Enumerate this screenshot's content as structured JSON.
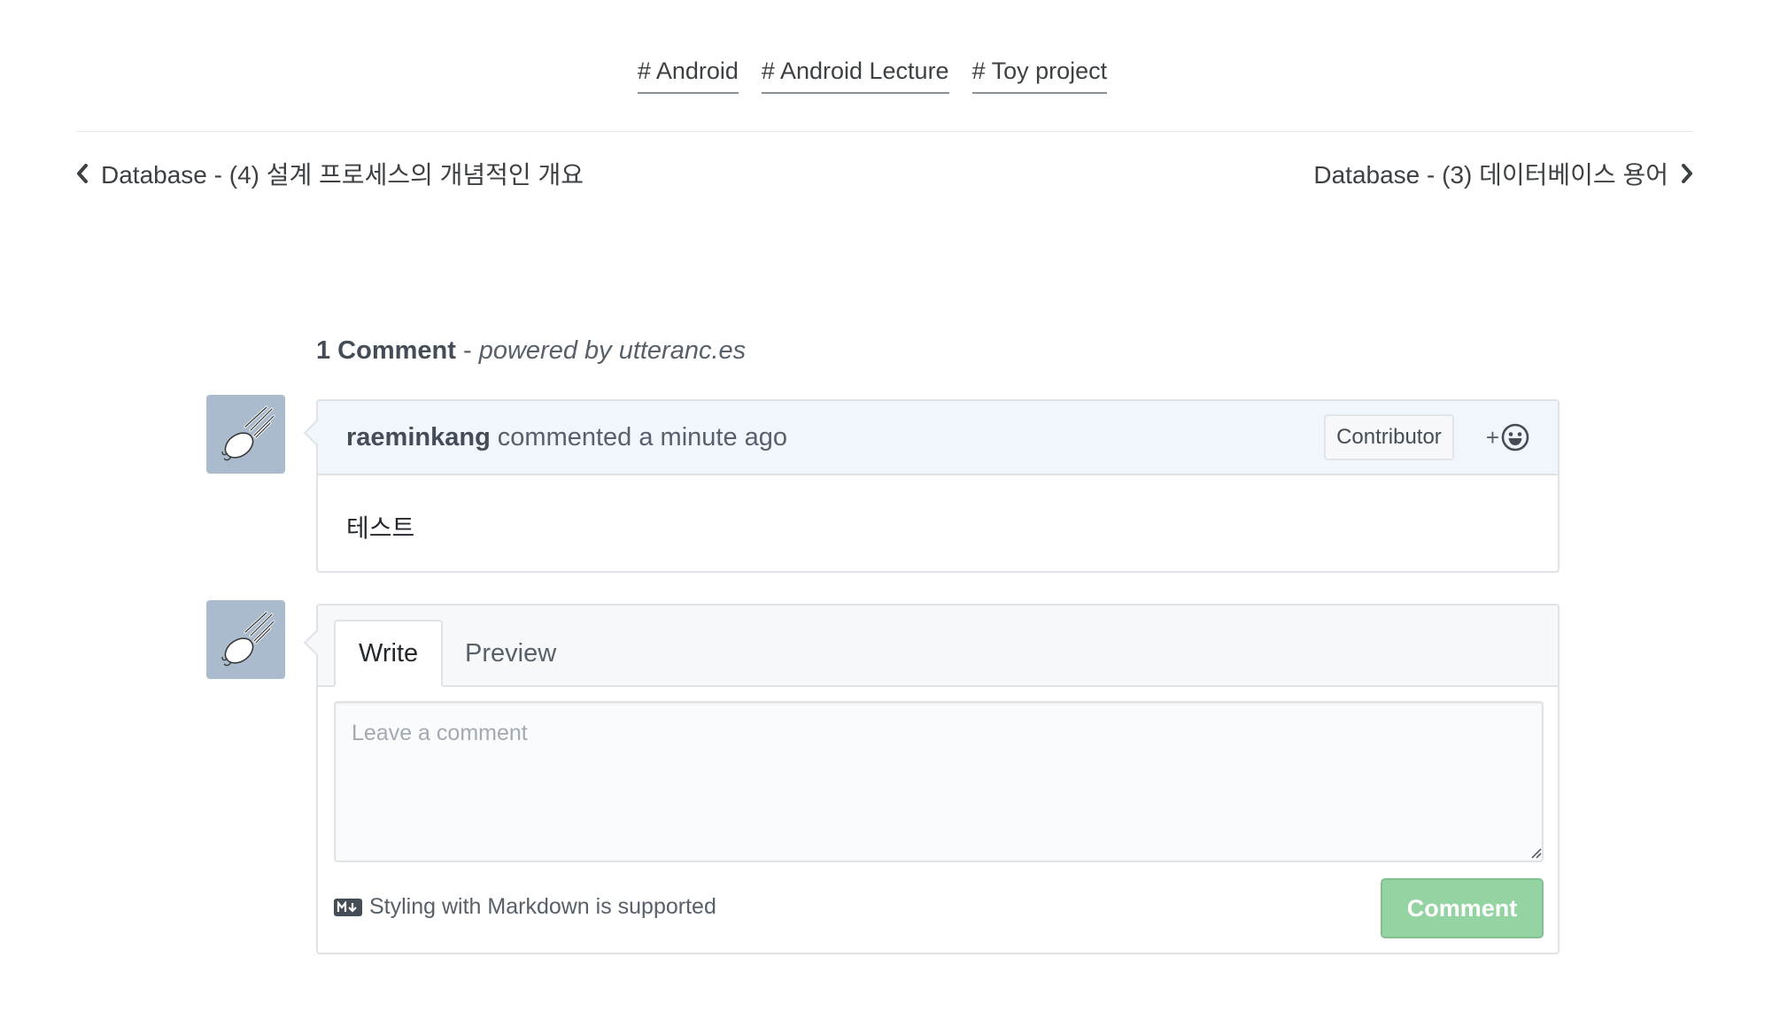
{
  "tags": [
    {
      "label": "# Android"
    },
    {
      "label": "# Android Lecture"
    },
    {
      "label": "# Toy project"
    }
  ],
  "post_nav": {
    "previous": {
      "label": "Database - (4) 설계 프로세스의 개념적인 개요",
      "icon": "chevron-left-icon"
    },
    "next": {
      "label": "Database - (3) 데이터베이스 용어",
      "icon": "chevron-right-icon"
    }
  },
  "comments_section": {
    "count_label": "1 Comment",
    "separator": " - ",
    "powered_by": "powered by utteranc.es"
  },
  "comment": {
    "author": "raeminkang",
    "action": "commented a minute ago",
    "badge": "Contributor",
    "reaction_label": "+",
    "reaction_icon": "smiley-icon",
    "body": "테스트",
    "avatar_icon": "comet-avatar-icon"
  },
  "form": {
    "tabs": [
      {
        "label": "Write",
        "active": true
      },
      {
        "label": "Preview",
        "active": false
      }
    ],
    "placeholder": "Leave a comment",
    "markdown_note": "Styling with Markdown is supported",
    "markdown_icon": "markdown-icon",
    "submit_label": "Comment"
  },
  "colors": {
    "avatar_bg": "#a9bbcc",
    "header_bg": "#f1f6fd",
    "submit_disabled": "#94d3a2"
  }
}
